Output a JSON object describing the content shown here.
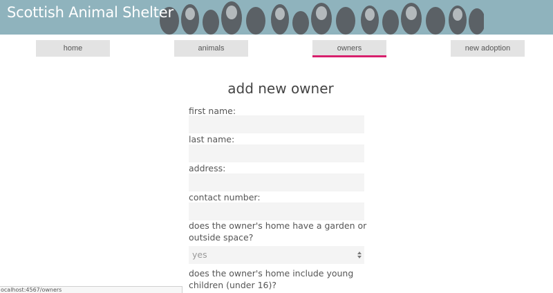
{
  "header": {
    "title": "Scottish Animal Shelter"
  },
  "nav": {
    "items": [
      {
        "label": "home"
      },
      {
        "label": "animals"
      },
      {
        "label": "owners"
      },
      {
        "label": "new adoption"
      }
    ],
    "active": "owners",
    "accent_color": "#d71f6c"
  },
  "form": {
    "title": "add new owner",
    "fields": {
      "first_name_label": "first name:",
      "last_name_label": "last name:",
      "address_label": "address:",
      "contact_label": "contact number:",
      "garden_label": "does the owner's home have a garden or outside space?",
      "garden_value": "yes",
      "children_label": "does the owner's home include young children (under 16)?"
    }
  },
  "status_bar": {
    "url": "ocalhost:4567/owners"
  },
  "colors": {
    "banner": "#8fb3bd",
    "nav_bg": "#e3e3e3",
    "field_bg": "#f4f4f4"
  }
}
